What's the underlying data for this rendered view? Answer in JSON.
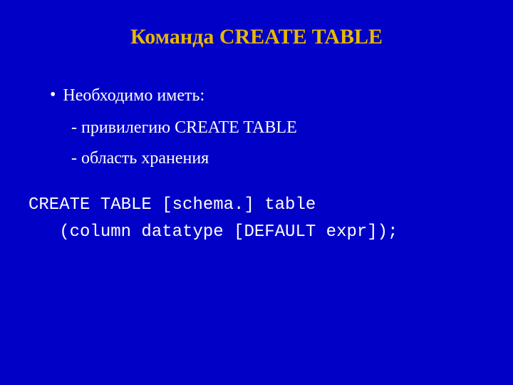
{
  "slide": {
    "title": "Команда CREATE TABLE",
    "bullet": {
      "text": "Необходимо иметь:"
    },
    "subitems": [
      "- привилегию CREATE TABLE",
      "- область хранения"
    ],
    "code": {
      "line1": "CREATE TABLE [schema.] table",
      "line2": "   (column datatype [DEFAULT expr]);"
    }
  }
}
